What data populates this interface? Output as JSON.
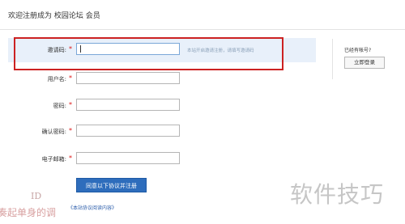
{
  "header": {
    "title": "欢迎注册成为 校园论坛 会员"
  },
  "form": {
    "fields": [
      {
        "label": "邀请码:",
        "required": "*",
        "value": "",
        "hint": "本站开启邀请注册，请填写邀请码"
      },
      {
        "label": "用户名:",
        "required": "*",
        "value": ""
      },
      {
        "label": "密码:",
        "required": "*",
        "value": ""
      },
      {
        "label": "确认密码:",
        "required": "*",
        "value": ""
      },
      {
        "label": "电子邮箱:",
        "required": "*",
        "value": ""
      }
    ],
    "submit_label": "同意以下协议并注册",
    "terms_link": "《本站协议阅读内容》"
  },
  "sidebar": {
    "have_account": "已经有帐号?",
    "login_label": "立即登录"
  },
  "watermarks": {
    "id_text": "ID",
    "left_text": "奏起单身的调",
    "right_text": "软件技巧"
  },
  "colors": {
    "highlight_row": "#e8f0fa",
    "invite_outline": "#cc2222",
    "submit_button": "#2e6dbc",
    "required_star": "#dd1111"
  }
}
